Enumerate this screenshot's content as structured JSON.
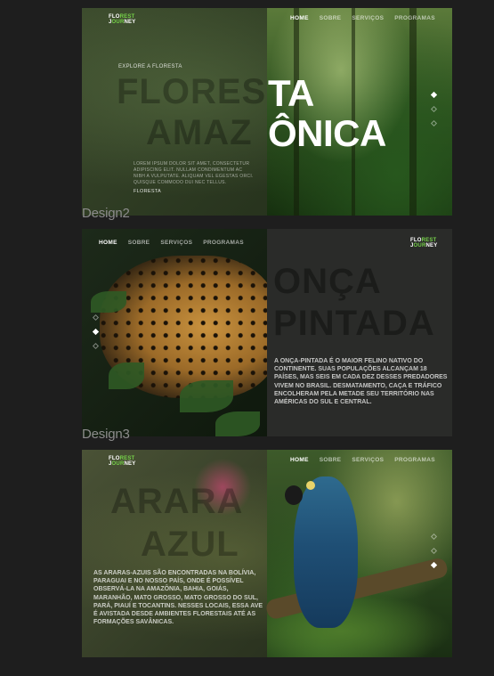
{
  "logo": {
    "line1_white": "FLO",
    "line1_green": "REST",
    "line2_white": "J",
    "line2_green": "OUR",
    "line2_end": "NEY"
  },
  "nav": [
    "HOME",
    "SOBRE",
    "SERVIÇOS",
    "PROGRAMAS"
  ],
  "design1": {
    "eyebrow": "EXPLORE A FLORESTA",
    "ghost_line1": "FLORES",
    "ghost_line2": "AMAZ",
    "title_line1": "TA",
    "title_line2": "ÔNICA",
    "lorem": "LOREM IPSUM DOLOR SIT AMET, CONSECTETUR ADIPISCING ELIT. NULLAM CONDIMENTUM AC NIBH A VULPUTATE. ALIQUAM VEL EGESTAS ORCI. QUISQUE COMMODO DUI NEC TELLUS.",
    "link": "FLORESTA",
    "active_dot": 0
  },
  "labels": {
    "design2": "Design2",
    "design3": "Design3"
  },
  "design2": {
    "title_line1": "ONÇA",
    "title_line2": "PINTADA",
    "text": "A ONÇA-PINTADA É O MAIOR FELINO NATIVO DO CONTINENTE. SUAS POPULAÇÕES ALCANÇAM 18 PAÍSES, MAS SEIS EM CADA DEZ DESSES PREDADORES VIVEM NO BRASIL. DESMATAMENTO, CAÇA E TRÁFICO ENCOLHERAM PELA METADE SEU TERRITÓRIO NAS AMÉRICAS DO SUL E CENTRAL.",
    "active_dot": 1
  },
  "design3": {
    "title_line1": "ARARA",
    "title_line2": "AZUL",
    "text": "AS ARARAS-AZUIS SÃO ENCONTRADAS NA BOLÍVIA, PARAGUAI E NO NOSSO PAÍS, ONDE É POSSÍVEL OBSERVÁ-LA NA AMAZÔNIA, BAHIA, GOIÁS, MARANHÃO, MATO GROSSO, MATO GROSSO DO SUL, PARÁ, PIAUÍ E TOCANTINS. NESSES LOCAIS, ESSA AVE É AVISTADA DESDE AMBIENTES FLORESTAIS ATÉ AS FORMAÇÕES SAVÂNICAS.",
    "active_dot": 2
  }
}
